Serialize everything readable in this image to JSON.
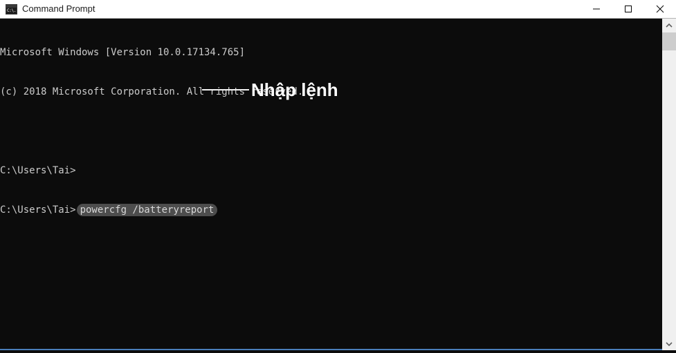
{
  "window": {
    "title": "Command Prompt",
    "icon": "command-prompt-icon",
    "icon_glyph": "C:\\.",
    "controls": {
      "minimize": "minimize-icon",
      "maximize": "maximize-icon",
      "close": "close-icon"
    }
  },
  "terminal": {
    "background_color": "#0c0c0c",
    "text_color": "#cccccc",
    "lines": [
      "Microsoft Windows [Version 10.0.17134.765]",
      "(c) 2018 Microsoft Corporation. All rights reserved.",
      "",
      "C:\\Users\\Tai>"
    ],
    "prompt": "C:\\Users\\Tai>",
    "command": "powercfg /batteryreport",
    "highlight_color": "#4d4d4d"
  },
  "annotation": {
    "label": "Nhập lệnh",
    "color": "#ffffff"
  },
  "scrollbar": {
    "up_arrow": "chevron-up-icon",
    "down_arrow": "chevron-down-icon",
    "track_color": "#f0f0f0",
    "thumb_color": "#cdcdcd"
  }
}
